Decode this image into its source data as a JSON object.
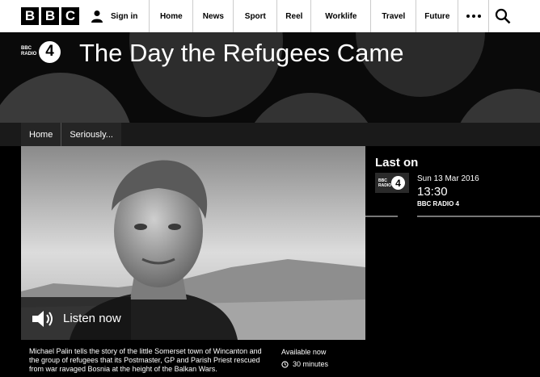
{
  "topbar": {
    "logo_letters": [
      "B",
      "B",
      "C"
    ],
    "signin_label": "Sign in",
    "nav": [
      "Home",
      "News",
      "Sport",
      "Reel",
      "Worklife",
      "Travel",
      "Future"
    ],
    "more_icon": "more-dots-icon",
    "search_icon": "search-icon"
  },
  "brand": {
    "badge_text": "BBC RADIO",
    "badge_number": "4",
    "title": "The Day the Refugees Came"
  },
  "breadcrumbs": [
    "Home",
    "Seriously..."
  ],
  "hero": {
    "listen_label": "Listen now",
    "listen_icon": "speaker-icon"
  },
  "last_on": {
    "heading": "Last on",
    "badge_text": "BBC RADIO",
    "badge_number": "4",
    "date": "Sun 13 Mar 2016",
    "time": "13:30",
    "station": "BBC RADIO 4"
  },
  "synopsis": "Michael Palin tells the story of the little Somerset town of Wincanton and the group of refugees that its Postmaster, GP and Parish Priest rescued from war ravaged Bosnia at the height of the Balkan Wars.",
  "availability": {
    "label": "Available now",
    "duration": "30 minutes",
    "clock_icon": "clock-icon"
  }
}
